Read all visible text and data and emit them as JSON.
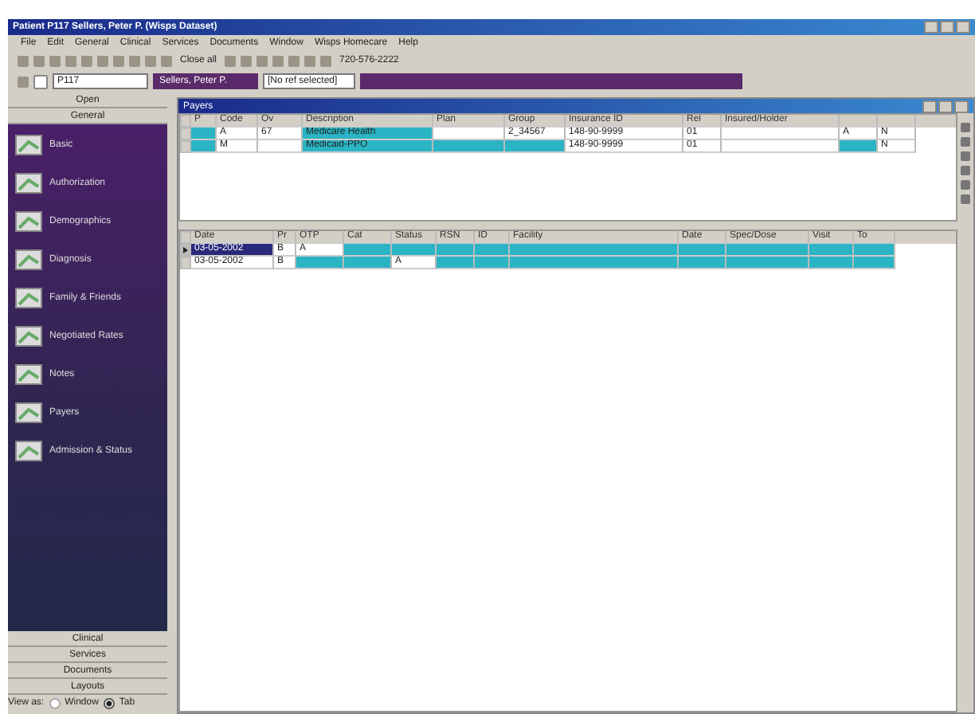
{
  "window": {
    "title": "Patient P117 Sellers, Peter P. (Wisps Dataset)"
  },
  "menu": [
    "File",
    "Edit",
    "General",
    "Clinical",
    "Services",
    "Documents",
    "Window",
    "Wisps Homecare",
    "Help"
  ],
  "toolbar": {
    "close_all": "Close all",
    "phone": "720-576-2222"
  },
  "patient_bar": {
    "patient_id": "P117",
    "patient_name": "Sellers, Peter P.",
    "selector": "[No ref selected]"
  },
  "sidebar": {
    "top_sections": [
      "Open",
      "General"
    ],
    "items": [
      {
        "label": "Basic"
      },
      {
        "label": "Authorization"
      },
      {
        "label": "Demographics"
      },
      {
        "label": "Diagnosis"
      },
      {
        "label": "Family & Friends"
      },
      {
        "label": "Negotiated Rates"
      },
      {
        "label": "Notes"
      },
      {
        "label": "Payers"
      },
      {
        "label": "Admission & Status"
      }
    ],
    "bottom_sections": [
      "Clinical",
      "Services",
      "Documents",
      "Layouts"
    ],
    "view_as": {
      "label": "View as:",
      "options": [
        {
          "label": "Window",
          "selected": false
        },
        {
          "label": "Tab",
          "selected": true
        }
      ]
    }
  },
  "payers": {
    "title": "Payers",
    "columns": [
      "P",
      "Code",
      "Ov",
      "Description",
      "Plan",
      "Group",
      "Insurance ID",
      "Rel",
      "Insured/Holder"
    ],
    "rows": [
      {
        "cells": [
          "",
          "A",
          "67",
          "Medicare Health",
          "",
          "2_34567",
          "148-90-9999",
          "01",
          "",
          "A",
          "N"
        ],
        "highlight": [
          true,
          false,
          false,
          true,
          false,
          false,
          false,
          false,
          false,
          false,
          false
        ]
      },
      {
        "cells": [
          "",
          "M",
          "",
          "Medicaid-PPO",
          "",
          "",
          "148-90-9999",
          "01",
          "",
          "",
          "N"
        ],
        "highlight": [
          true,
          false,
          false,
          true,
          true,
          true,
          false,
          false,
          false,
          true,
          false
        ]
      }
    ]
  },
  "visits": {
    "columns": [
      "Date",
      "Pr",
      "OTP",
      "Cat",
      "Status",
      "RSN",
      "ID",
      "Facility",
      "Date",
      "Spec/Dose",
      "Visit",
      "To"
    ],
    "rows": [
      {
        "selected": true,
        "cells": [
          "03-05-2002",
          "B",
          "A",
          "",
          "",
          "",
          "",
          "",
          "",
          "",
          "",
          ""
        ],
        "highlight": [
          false,
          false,
          false,
          true,
          true,
          true,
          true,
          true,
          true,
          true,
          true,
          true
        ]
      },
      {
        "selected": false,
        "cells": [
          "03-05-2002",
          "B",
          "",
          "",
          "A",
          "",
          "",
          "",
          "",
          "",
          "",
          ""
        ],
        "highlight": [
          false,
          false,
          true,
          true,
          false,
          true,
          true,
          true,
          true,
          true,
          true,
          true
        ]
      }
    ]
  }
}
